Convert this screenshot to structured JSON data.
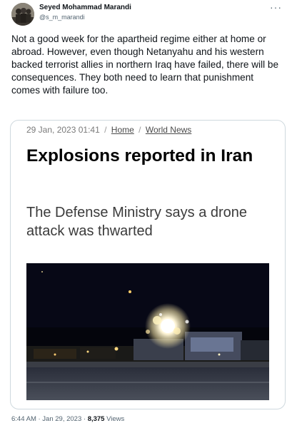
{
  "author": {
    "name": "Seyed Mohammad Marandi",
    "handle": "@s_m_marandi"
  },
  "tweet": {
    "text": "Not a good week for the apartheid regime either at home or abroad. However, even though Netanyahu and his western backed terrorist allies in northern Iraq have failed, there will be consequences. They both need to learn that punishment comes with failure too."
  },
  "card": {
    "timestamp": "29 Jan, 2023 01:41",
    "crumb_home": "Home",
    "crumb_section": "World News",
    "headline": "Explosions reported in Iran",
    "subheadline": "The Defense Ministry says a drone attack was thwarted"
  },
  "footer": {
    "time": "6:44 AM · Jan 29, 2023 · ",
    "views_count": "8,375",
    "views_label": " Views"
  },
  "icons": {
    "more": "more-icon"
  }
}
